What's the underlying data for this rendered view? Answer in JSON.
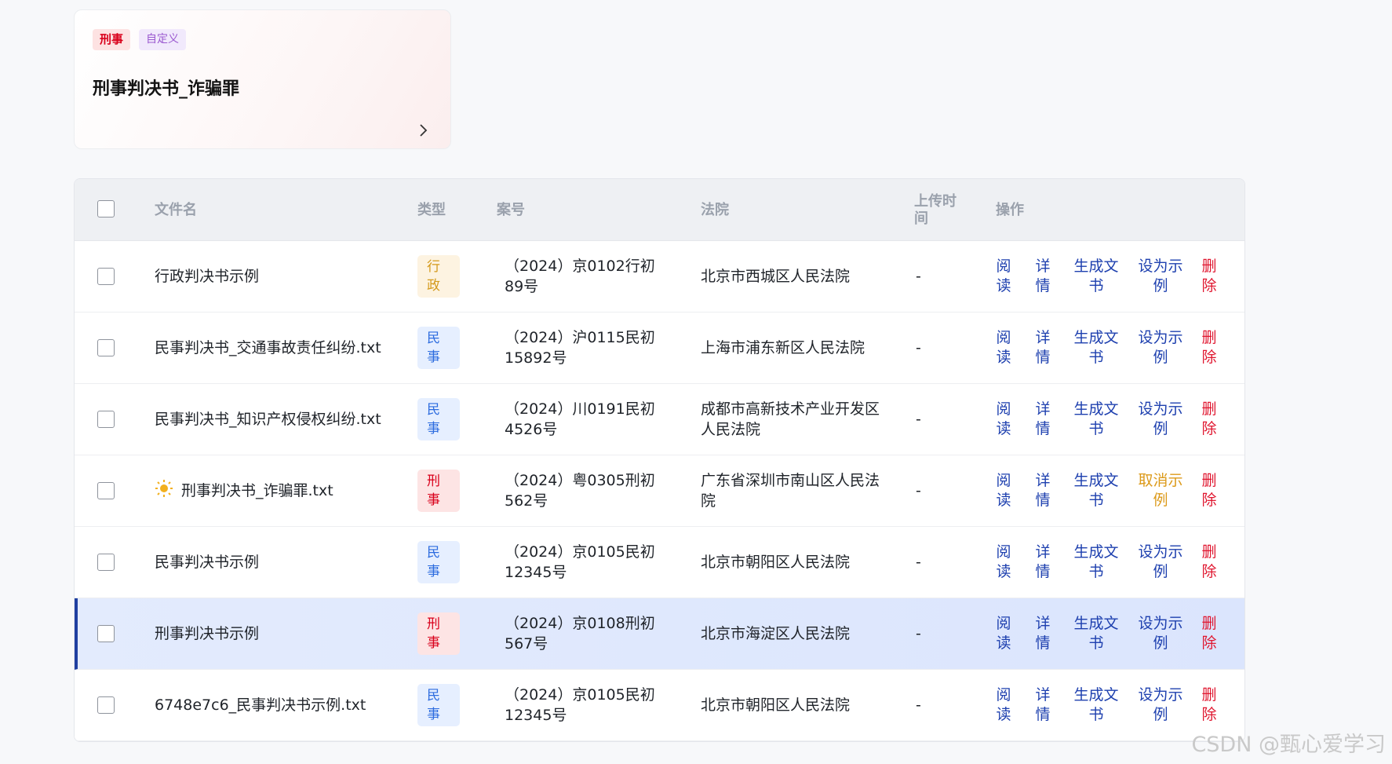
{
  "card": {
    "tags": [
      "刑事",
      "自定义"
    ],
    "title": "刑事判决书_诈骗罪"
  },
  "table": {
    "headers": {
      "name": "文件名",
      "type": "类型",
      "case_no": "案号",
      "court": "法院",
      "upload_time": "上传时间",
      "actions": "操作"
    },
    "rows": [
      {
        "name": "行政判决书示例",
        "type": "行政",
        "type_kind": "admin",
        "case_no": "（2024）京0102行初89号",
        "court": "北京市西城区人民法院",
        "upload_time": "-",
        "example_label": "设为示例",
        "has_icon": false,
        "selected": false
      },
      {
        "name": "民事判决书_交通事故责任纠纷.txt",
        "type": "民事",
        "type_kind": "civil",
        "case_no": "（2024）沪0115民初15892号",
        "court": "上海市浦东新区人民法院",
        "upload_time": "-",
        "example_label": "设为示例",
        "has_icon": false,
        "selected": false
      },
      {
        "name": "民事判决书_知识产权侵权纠纷.txt",
        "type": "民事",
        "type_kind": "civil",
        "case_no": "（2024）川0191民初4526号",
        "court": "成都市高新技术产业开发区人民法院",
        "upload_time": "-",
        "example_label": "设为示例",
        "has_icon": false,
        "selected": false
      },
      {
        "name": "刑事判决书_诈骗罪.txt",
        "type": "刑事",
        "type_kind": "criminal",
        "case_no": "（2024）粤0305刑初562号",
        "court": "广东省深圳市南山区人民法院",
        "upload_time": "-",
        "example_label": "取消示例",
        "has_icon": true,
        "selected": false
      },
      {
        "name": "民事判决书示例",
        "type": "民事",
        "type_kind": "civil",
        "case_no": "（2024）京0105民初12345号",
        "court": "北京市朝阳区人民法院",
        "upload_time": "-",
        "example_label": "设为示例",
        "has_icon": false,
        "selected": false
      },
      {
        "name": "刑事判决书示例",
        "type": "刑事",
        "type_kind": "criminal",
        "case_no": "（2024）京0108刑初567号",
        "court": "北京市海淀区人民法院",
        "upload_time": "-",
        "example_label": "设为示例",
        "has_icon": false,
        "selected": true
      },
      {
        "name": "6748e7c6_民事判决书示例.txt",
        "type": "民事",
        "type_kind": "civil",
        "case_no": "（2024）京0105民初12345号",
        "court": "北京市朝阳区人民法院",
        "upload_time": "-",
        "example_label": "设为示例",
        "has_icon": false,
        "selected": false
      }
    ],
    "actions": {
      "read": "阅读",
      "detail": "详情",
      "generate": "生成文书",
      "delete": "删除"
    }
  },
  "badge_colors": {
    "admin": {
      "bg": "#fdf3e1",
      "fg": "#d49a1c"
    },
    "civil": {
      "bg": "#e6efff",
      "fg": "#2d6cdf"
    },
    "criminal": {
      "bg": "#fde4e4",
      "fg": "#d9001b"
    }
  },
  "watermark": "CSDN @甄心爱学习"
}
